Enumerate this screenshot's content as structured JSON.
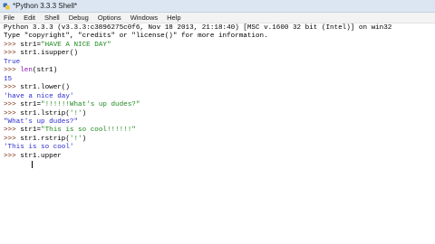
{
  "window": {
    "title": "*Python 3.3.3 Shell*"
  },
  "menu": {
    "items": [
      "File",
      "Edit",
      "Shell",
      "Debug",
      "Options",
      "Windows",
      "Help"
    ]
  },
  "shell": {
    "lines": [
      [
        {
          "t": "Python 3.3.3 (v3.3.3:c3896275c0f6, Nov 18 2013, 21:18:40) [MSC v.1600 32 bit (Intel)] on win32",
          "c": "plain"
        }
      ],
      [
        {
          "t": "Type \"copyright\", \"credits\" or \"license()\" for more information.",
          "c": "plain"
        }
      ],
      [
        {
          "t": ">>> ",
          "c": "prompt"
        },
        {
          "t": "str1=",
          "c": "plain"
        },
        {
          "t": "\"HAVE A NICE DAY\"",
          "c": "str"
        }
      ],
      [
        {
          "t": ">>> ",
          "c": "prompt"
        },
        {
          "t": "str1.isupper()",
          "c": "plain"
        }
      ],
      [
        {
          "t": "True",
          "c": "out"
        }
      ],
      [
        {
          "t": ">>> ",
          "c": "prompt"
        },
        {
          "t": "len",
          "c": "kw"
        },
        {
          "t": "(str1)",
          "c": "plain"
        }
      ],
      [
        {
          "t": "15",
          "c": "out"
        }
      ],
      [
        {
          "t": ">>> ",
          "c": "prompt"
        },
        {
          "t": "str1.lower()",
          "c": "plain"
        }
      ],
      [
        {
          "t": "'have a nice day'",
          "c": "out"
        }
      ],
      [
        {
          "t": ">>> ",
          "c": "prompt"
        },
        {
          "t": "str1=",
          "c": "plain"
        },
        {
          "t": "\"!!!!!!What's up dudes?\"",
          "c": "str"
        }
      ],
      [
        {
          "t": ">>> ",
          "c": "prompt"
        },
        {
          "t": "str1.lstrip(",
          "c": "plain"
        },
        {
          "t": "'!'",
          "c": "str"
        },
        {
          "t": ")",
          "c": "plain"
        }
      ],
      [
        {
          "t": "\"What's up dudes?\"",
          "c": "out"
        }
      ],
      [
        {
          "t": ">>> ",
          "c": "prompt"
        },
        {
          "t": "str1=",
          "c": "plain"
        },
        {
          "t": "\"This is so cool!!!!!!\"",
          "c": "str"
        }
      ],
      [
        {
          "t": ">>> ",
          "c": "prompt"
        },
        {
          "t": "str1.rstrip(",
          "c": "plain"
        },
        {
          "t": "'!'",
          "c": "str"
        },
        {
          "t": ")",
          "c": "plain"
        }
      ],
      [
        {
          "t": "'This is so cool'",
          "c": "out"
        }
      ],
      [
        {
          "t": ">>> ",
          "c": "prompt"
        },
        {
          "t": "str1.upper",
          "c": "plain"
        }
      ]
    ]
  },
  "colors": {
    "prompt": "#7a2f12",
    "keyword": "#8a16b3",
    "string": "#1f8a1f",
    "output": "#2c2ccf",
    "text": "#000000"
  }
}
